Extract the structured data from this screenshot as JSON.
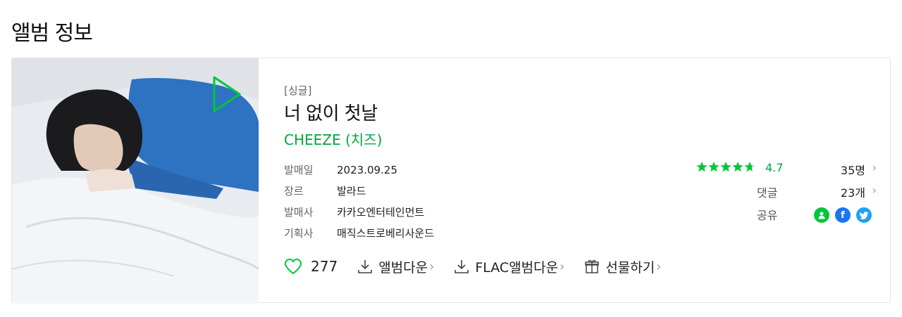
{
  "page": {
    "title": "앨범 정보"
  },
  "album": {
    "type": "[싱글]",
    "title": "너 없이 첫날",
    "artist": "CHEEZE (치즈)",
    "meta": [
      {
        "key": "발매일",
        "value": "2023.09.25"
      },
      {
        "key": "장르",
        "value": "발라드"
      },
      {
        "key": "발매사",
        "value": "카카오엔터테인먼트"
      },
      {
        "key": "기획사",
        "value": "매직스트로베리사운드"
      }
    ]
  },
  "actions": {
    "like_count": "277",
    "album_download": "앨범다운",
    "flac_download": "FLAC앨범다운",
    "gift": "선물하기"
  },
  "stats": {
    "rating": 4.7,
    "rating_text": "4.7",
    "rating_people": "35명",
    "comment_label": "댓글",
    "comment_count": "23개",
    "share_label": "공유"
  },
  "colors": {
    "accent": "#00a73c",
    "facebook": "#1877f2",
    "twitter": "#1da1f2"
  },
  "icons": [
    "play-icon",
    "heart-icon",
    "download-icon",
    "gift-icon",
    "star-icon",
    "chevron-right-icon",
    "kakao-share-icon",
    "facebook-icon",
    "twitter-icon"
  ]
}
